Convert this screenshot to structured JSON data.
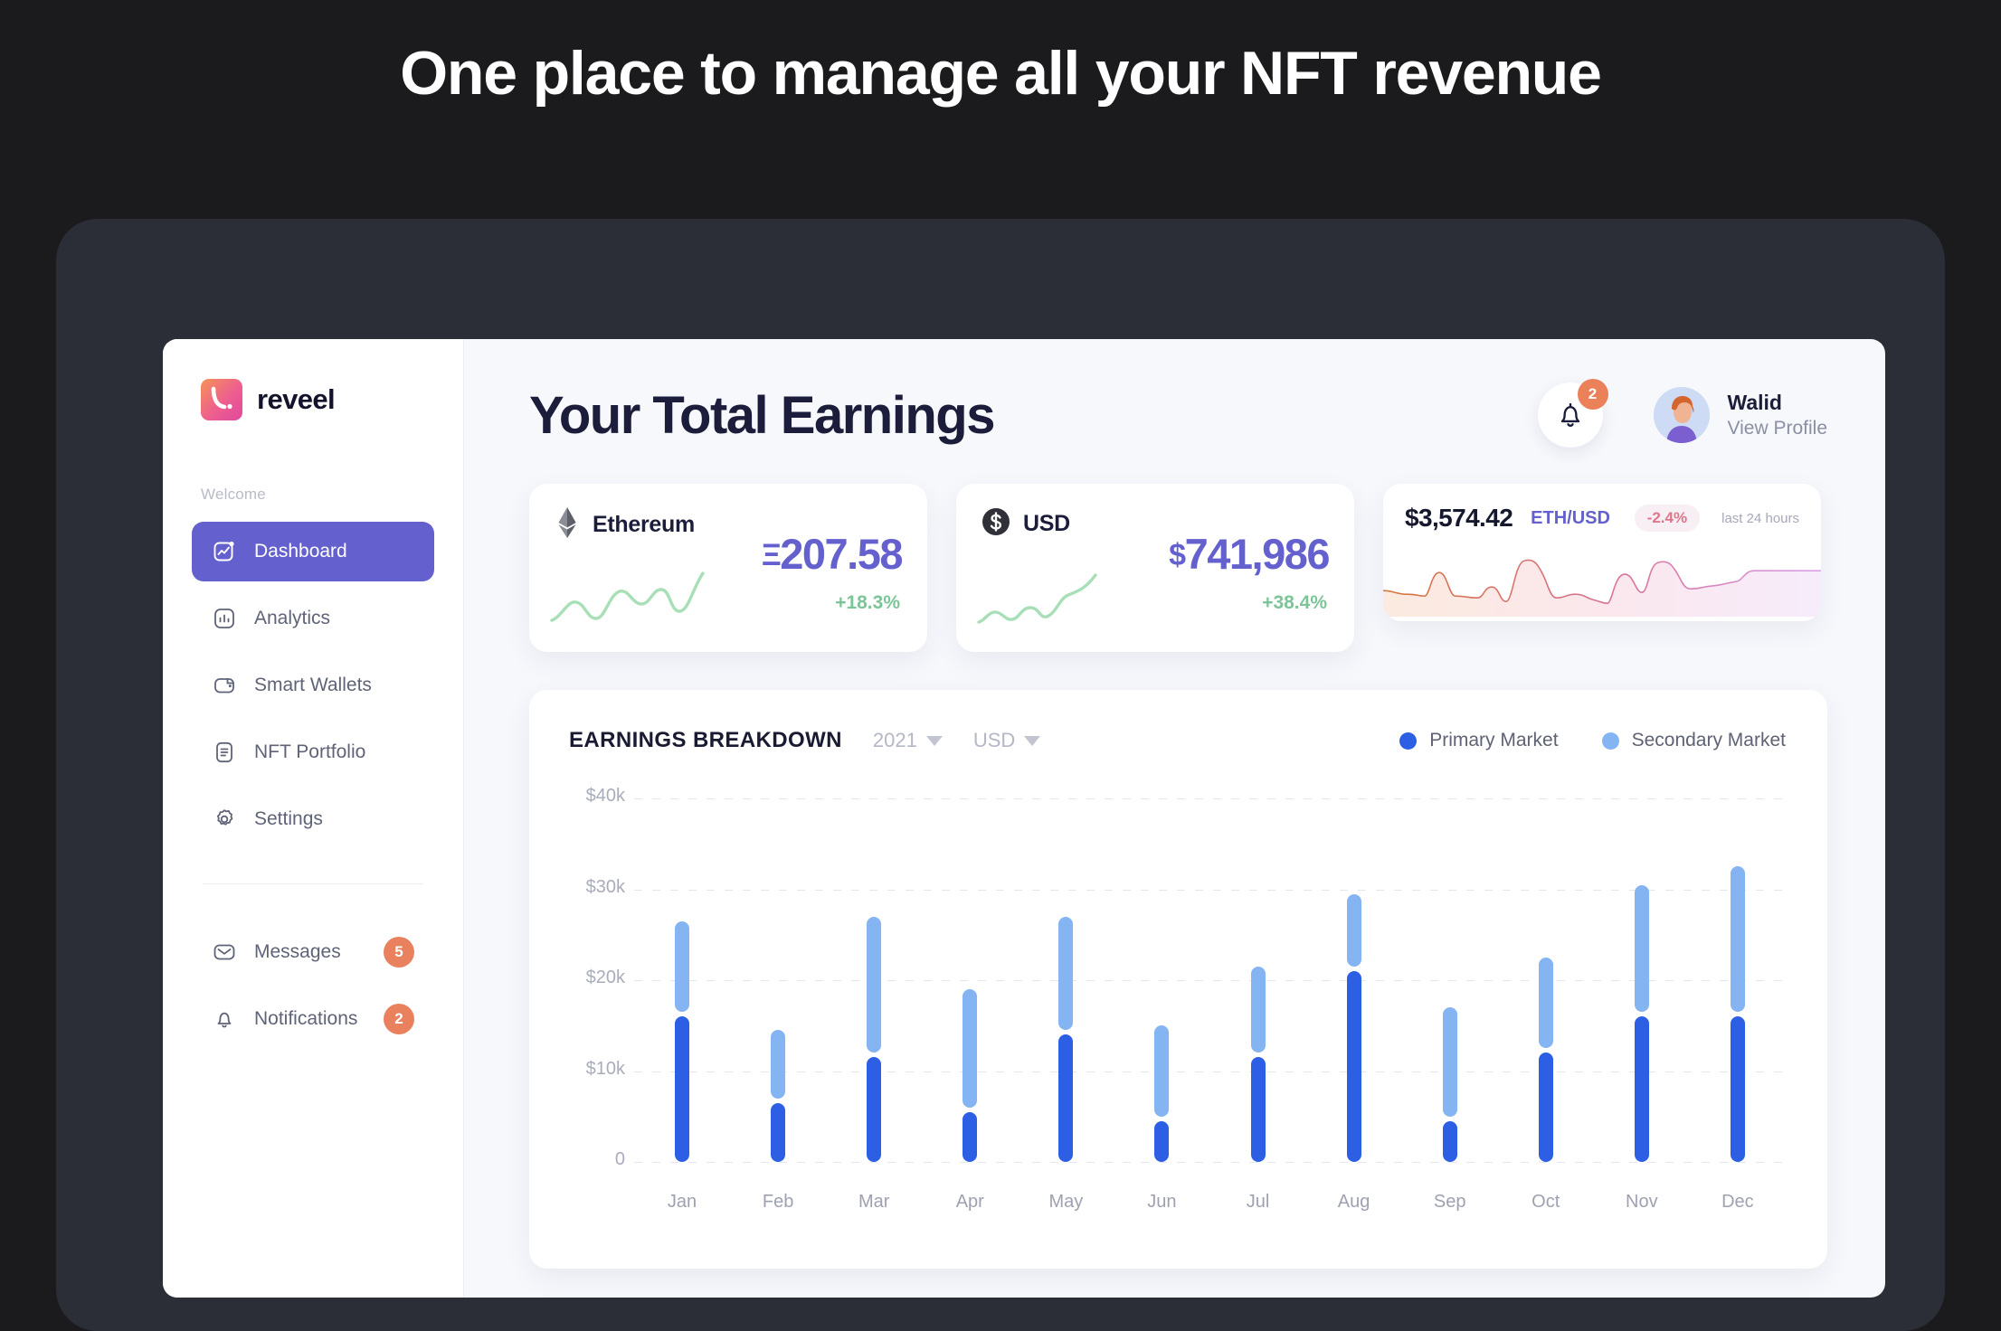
{
  "headline": "One place to manage all your NFT revenue",
  "sidebar": {
    "brand": "reveel",
    "welcome_label": "Welcome",
    "items": [
      {
        "label": "Dashboard",
        "icon": "dashboard-icon",
        "active": true
      },
      {
        "label": "Analytics",
        "icon": "analytics-icon",
        "active": false
      },
      {
        "label": "Smart Wallets",
        "icon": "wallet-icon",
        "active": false
      },
      {
        "label": "NFT Portfolio",
        "icon": "portfolio-icon",
        "active": false
      },
      {
        "label": "Settings",
        "icon": "gear-icon",
        "active": false
      }
    ],
    "footer_items": [
      {
        "label": "Messages",
        "icon": "envelope-icon",
        "badge": "5"
      },
      {
        "label": "Notifications",
        "icon": "bell-icon",
        "badge": "2"
      }
    ]
  },
  "header": {
    "title": "Your Total Earnings",
    "notification_badge": "2",
    "profile_name": "Walid",
    "profile_link": "View Profile"
  },
  "cards": [
    {
      "name": "Ethereum",
      "icon": "ethereum-icon",
      "symbol": "Ξ",
      "value": "207.58",
      "delta": "+18.3%",
      "delta_color": "#7cc598"
    },
    {
      "name": "USD",
      "icon": "dollar-icon",
      "symbol": "$",
      "value": "741,986",
      "delta": "+38.4%",
      "delta_color": "#7cc598"
    }
  ],
  "price_card": {
    "price": "$3,574.42",
    "pair": "ETH/USD",
    "change": "-2.4%",
    "period": "last 24 hours",
    "change_color": "#e0758c"
  },
  "colors": {
    "accent_purple": "#6460ce",
    "primary_market": "#2c5fe4",
    "secondary_market": "#85b4f2",
    "badge_orange": "#e9815e",
    "page_bg": "#1b1b1d",
    "frame": "#2c2e37",
    "app_bg": "#f7f8fc"
  },
  "chart_data": {
    "type": "bar",
    "title": "EARNINGS BREAKDOWN",
    "year_filter": "2021",
    "currency_filter": "USD",
    "categories": [
      "Jan",
      "Feb",
      "Mar",
      "Apr",
      "May",
      "Jun",
      "Jul",
      "Aug",
      "Sep",
      "Oct",
      "Nov",
      "Dec"
    ],
    "series": [
      {
        "name": "Primary Market",
        "color": "#2c5fe4",
        "values": [
          16000,
          6500,
          11500,
          5500,
          14000,
          4500,
          11500,
          21000,
          4500,
          12000,
          16000,
          16000
        ]
      },
      {
        "name": "Secondary Market",
        "color": "#85b4f2",
        "values": [
          10000,
          7500,
          15000,
          13000,
          12500,
          10000,
          9500,
          8000,
          12000,
          10000,
          14000,
          16000
        ]
      }
    ],
    "stacked": true,
    "ylabel": "",
    "xlabel": "",
    "ylim": [
      0,
      40000
    ],
    "yticks": [
      "0",
      "$10k",
      "$20k",
      "$30k",
      "$40k"
    ],
    "grid": true,
    "legend_position": "top-right",
    "legend": [
      "Primary Market",
      "Secondary Market"
    ]
  }
}
